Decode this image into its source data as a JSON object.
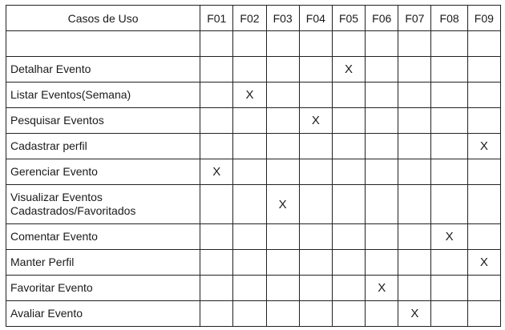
{
  "table": {
    "header_usecase": "Casos de Uso",
    "columns": [
      "F01",
      "F02",
      "F03",
      "F04",
      "F05",
      "F06",
      "F07",
      "F08",
      "F09"
    ],
    "mark_symbol": "X",
    "rows": [
      {
        "use_case": "",
        "marks": [
          "",
          "",
          "",
          "",
          "",
          "",
          "",
          "",
          ""
        ]
      },
      {
        "use_case": "Detalhar Evento",
        "marks": [
          "",
          "",
          "",
          "",
          "X",
          "",
          "",
          "",
          ""
        ]
      },
      {
        "use_case": "Listar Eventos(Semana)",
        "marks": [
          "",
          "X",
          "",
          "",
          "",
          "",
          "",
          "",
          ""
        ]
      },
      {
        "use_case": "Pesquisar Eventos",
        "marks": [
          "",
          "",
          "",
          "X",
          "",
          "",
          "",
          "",
          ""
        ]
      },
      {
        "use_case": "Cadastrar perfil",
        "marks": [
          "",
          "",
          "",
          "",
          "",
          "",
          "",
          "",
          "X"
        ]
      },
      {
        "use_case": "Gerenciar Evento",
        "marks": [
          "X",
          "",
          "",
          "",
          "",
          "",
          "",
          "",
          ""
        ]
      },
      {
        "use_case": "Visualizar Eventos Cadastrados/Favoritados",
        "marks": [
          "",
          "",
          "X",
          "",
          "",
          "",
          "",
          "",
          ""
        ]
      },
      {
        "use_case": "Comentar Evento",
        "marks": [
          "",
          "",
          "",
          "",
          "",
          "",
          "",
          "X",
          ""
        ]
      },
      {
        "use_case": "Manter Perfil",
        "marks": [
          "",
          "",
          "",
          "",
          "",
          "",
          "",
          "",
          "X"
        ]
      },
      {
        "use_case": "Favoritar Evento",
        "marks": [
          "",
          "",
          "",
          "",
          "",
          "X",
          "",
          "",
          ""
        ]
      },
      {
        "use_case": "Avaliar Evento",
        "marks": [
          "",
          "",
          "",
          "",
          "",
          "",
          "X",
          "",
          ""
        ]
      }
    ]
  }
}
